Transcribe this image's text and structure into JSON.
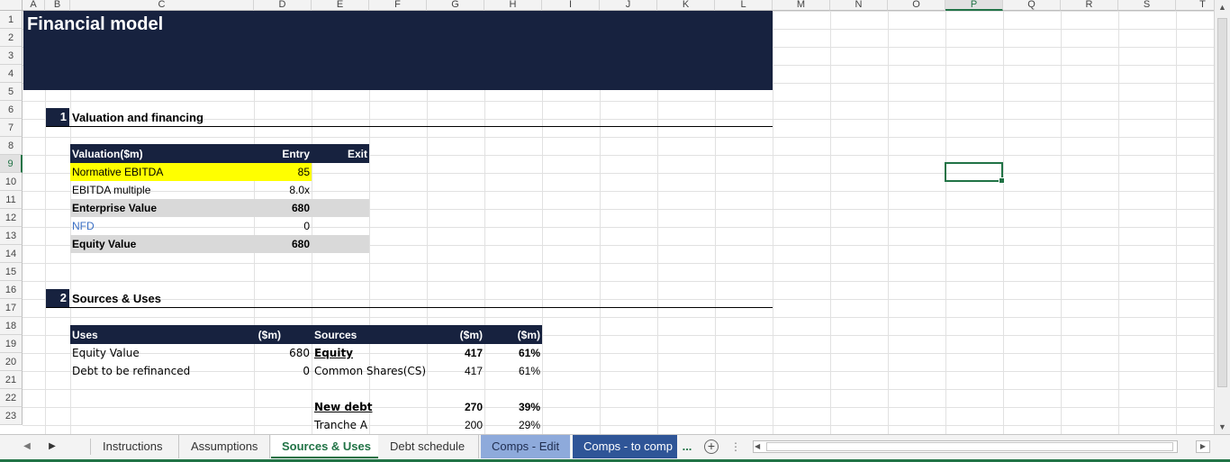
{
  "columns": [
    "A",
    "B",
    "C",
    "D",
    "E",
    "F",
    "G",
    "H",
    "I",
    "J",
    "K",
    "L",
    "M",
    "N",
    "O",
    "P",
    "Q",
    "R",
    "S",
    "T"
  ],
  "rows": [
    "1",
    "2",
    "3",
    "4",
    "5",
    "6",
    "7",
    "8",
    "9",
    "10",
    "11",
    "12",
    "13",
    "14",
    "15",
    "16",
    "17",
    "18",
    "19",
    "20",
    "21",
    "22",
    "23"
  ],
  "selected_column": "P",
  "selected_row": "9",
  "header": {
    "title": "Financial model"
  },
  "section1": {
    "number": "1",
    "title": "Valuation and financing"
  },
  "valuation": {
    "header": {
      "label": "Valuation($m)",
      "entry": "Entry",
      "exit": "Exit"
    },
    "rows": [
      {
        "label": "Normative EBITDA",
        "entry": "85"
      },
      {
        "label": "EBITDA multiple",
        "entry": "8.0x"
      },
      {
        "label": "Enterprise Value",
        "entry": "680"
      },
      {
        "label": "NFD",
        "entry": "0"
      },
      {
        "label": "Equity Value",
        "entry": "680"
      }
    ]
  },
  "section2": {
    "number": "2",
    "title": "Sources & Uses"
  },
  "sources_uses": {
    "header": {
      "uses": "Uses",
      "uses_unit": "($m)",
      "sources": "Sources",
      "sources_unit": "($m)",
      "pct_unit": "($m)"
    },
    "uses": [
      {
        "label": "Equity Value",
        "value": "680"
      },
      {
        "label": "Debt to be refinanced",
        "value": "0"
      }
    ],
    "sources": [
      {
        "label": "Equity",
        "value": "417",
        "pct": "61%"
      },
      {
        "label": "Common Shares(CS)",
        "value": "417",
        "pct": "61%"
      },
      {
        "label": "New debt",
        "value": "270",
        "pct": "39%"
      },
      {
        "label": "Tranche A",
        "value": "200",
        "pct": "29%"
      }
    ]
  },
  "tabs": [
    {
      "label": "Instructions"
    },
    {
      "label": "Assumptions"
    },
    {
      "label": "Sources & Uses"
    },
    {
      "label": "Debt schedule"
    },
    {
      "label": "Comps - Edit"
    },
    {
      "label": "Comps - to comp"
    }
  ],
  "tab_overflow": "...",
  "icons": {
    "add_sheet": "+",
    "more": "⋮",
    "prev": "◀",
    "next": "▶",
    "scroll_up": "▲",
    "scroll_down": "▼",
    "scroll_left": "◀",
    "scroll_right": "▶"
  },
  "colors": {
    "navy": "#17223f",
    "highlight": "#ffff00",
    "grey": "#d9d9d9",
    "accent": "#217346",
    "tab_light_blue": "#8eaadb",
    "tab_dark_blue": "#2f5597"
  }
}
